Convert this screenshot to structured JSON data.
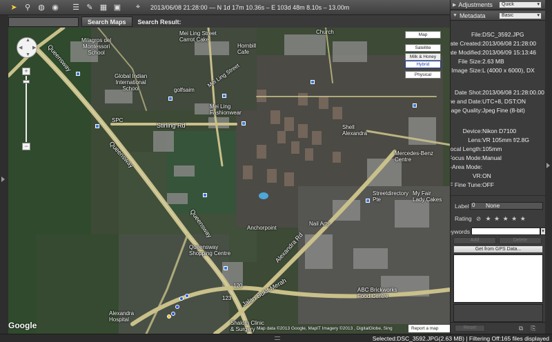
{
  "toolbar": {
    "coordinates": "2013/06/08 21:28:00 — N 1d 17m 10.36s – E 103d 48m 8.10s – 13.00m",
    "tools": [
      "select-tool",
      "pin-tool",
      "compass-tool",
      "globe-tool",
      "list-tool",
      "settings-tool",
      "map-tool",
      "crosshair-tool"
    ]
  },
  "search": {
    "input_value": "",
    "button_label": "Search Maps",
    "result_label": "Search Result:"
  },
  "map": {
    "type_buttons": {
      "map": "Map",
      "satellite": "Satellite",
      "milk_honey": "Milk & Honey",
      "hybrid": "Hybrid",
      "physical": "Physical"
    },
    "labels": {
      "queensway_1": "Queensway",
      "queensway_2": "Queensway",
      "queensway_3": "Queensway",
      "alexandra_rd": "Alexandra Rd",
      "jalan_bukit_merah": "Jalan Bukit Merah",
      "stirling_rd": "Stirling Rd",
      "mei_ling_st": "Mei Ling Street",
      "milagros": "Milagros del\nMontessori\nSchool",
      "global_indian": "Global Indian\nInternational\nSchool",
      "mei_ling_carrot": "Mei Ling Street\nCarrot Cake",
      "hornbill": "Hornbill\nCafe",
      "church": "Church",
      "golfsaim": "golfsaim",
      "mei_ling_fashion": "Mei Ling\nFashionwear",
      "spc": "SPC",
      "shell": "Shell\nAlexandra",
      "mercedes": "Mercedes-Benz\nCentre",
      "streetdirectory": "Streetdirectory\nPte",
      "my_fair_lady": "My Fair\nLady Cakes",
      "anchorpoint": "Anchorpoint",
      "nail_arts": "Nail Arts",
      "queensway_sc": "Queensway\nShopping Centre",
      "abc_brickworks": "ABC Brickworks\nFood Centre",
      "alexandra_hospital": "Alexandra\nHospital",
      "shalom": "Shalom Clinic\n& Surgery",
      "num_120": "120",
      "num_123": "123"
    },
    "google_logo": "Google",
    "attribution": "Map data ©2013 Google, MapIT  Imagery ©2013 , DigitalGlobe, Sing",
    "report_error": "Report a map error"
  },
  "panel": {
    "adjustments": {
      "title": "Adjustments",
      "mode": "Quick"
    },
    "metadata": {
      "title": "Metadata",
      "mode": "Basic"
    },
    "rows": [
      {
        "key": "File:",
        "value": "DSC_3592.JPG"
      },
      {
        "key": "Date Created:",
        "value": "2013/06/08 21:28:00"
      },
      {
        "key": "Date Modified:",
        "value": "2013/06/09 15:13:46"
      },
      {
        "key": "File Size:",
        "value": "2.63 MB"
      },
      {
        "key": "Image Size:",
        "value": "L (4000 x 6000), DX"
      },
      {
        "key": "Date Shot:",
        "value": "2013/06/08 21:28:00.00"
      },
      {
        "key": "Time Zone and Date:",
        "value": "UTC+8, DST:ON"
      },
      {
        "key": "Image Quality:",
        "value": "Jpeg Fine (8-bit)"
      },
      {
        "key": "Device:",
        "value": "Nikon D7100"
      },
      {
        "key": "Lens:",
        "value": "VR 105mm f/2.8G"
      },
      {
        "key": "Focal Length:",
        "value": "105mm"
      },
      {
        "key": "Focus Mode:",
        "value": "Manual"
      },
      {
        "key": "AF-Area Mode:",
        "value": ""
      },
      {
        "key": "VR:",
        "value": "ON"
      },
      {
        "key": "AF Fine Tune:",
        "value": "OFF"
      }
    ],
    "label": {
      "key": "Label",
      "number": "0",
      "value": "None"
    },
    "rating": {
      "key": "Rating",
      "stars": "★ ★ ★ ★ ★"
    },
    "keywords": {
      "key": "Keywords",
      "value": ""
    },
    "kw_add": "Add",
    "kw_delete": "Delete",
    "gps_button": "Get from GPS Data...",
    "reset": "Reset"
  },
  "status": {
    "text": "Selected:DSC_3592.JPG(2.63 MB) | Filtering Off:165 files displayed"
  }
}
